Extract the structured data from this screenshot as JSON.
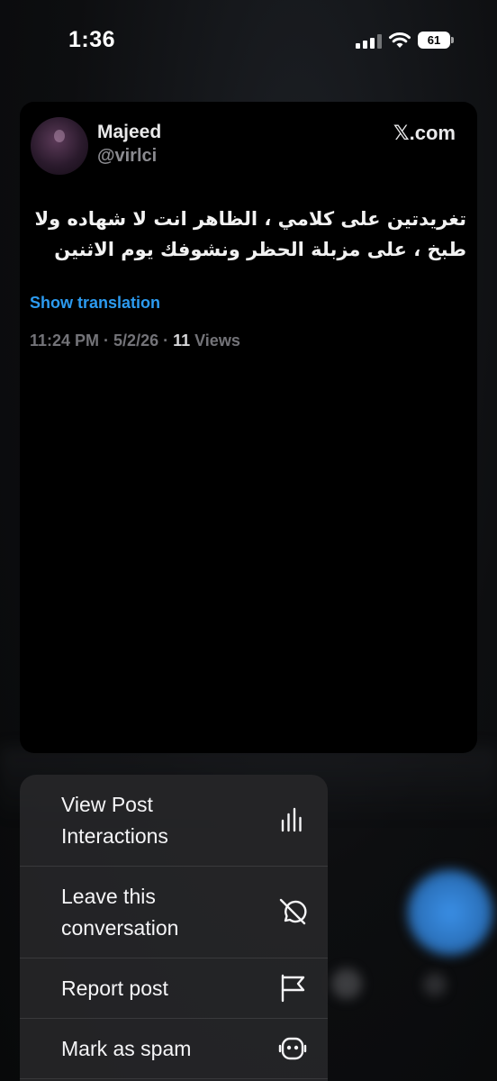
{
  "status_bar": {
    "time": "1:36",
    "battery_level": "61"
  },
  "post": {
    "author_name": "Majeed",
    "author_handle": "@virlci",
    "brand_x": "𝕏",
    "brand_domain": ".com",
    "text_line1": "تغريدتين على كلامي ، الظاهر انت لا شهاده ولا",
    "text_line2": "طبخ ، على مزبلة الحظر ونشوفك يوم الاثنين",
    "show_translation": "Show translation",
    "timestamp": "11:24 PM · 5/2/26 · ",
    "views_count": "11",
    "views_label": " Views"
  },
  "menu": {
    "items": [
      {
        "label_line1": "View Post",
        "label_line2": "Interactions",
        "icon": "bar-chart-icon"
      },
      {
        "label_line1": "Leave this",
        "label_line2": "conversation",
        "icon": "mute-conversation-icon"
      },
      {
        "label_line1": "Report post",
        "icon": "flag-icon"
      },
      {
        "label_line1": "Mark as spam",
        "icon": "robot-icon"
      }
    ]
  },
  "colors": {
    "accent_link": "#2c9bf0",
    "card_bg": "#000000",
    "menu_bg": "#262628"
  }
}
